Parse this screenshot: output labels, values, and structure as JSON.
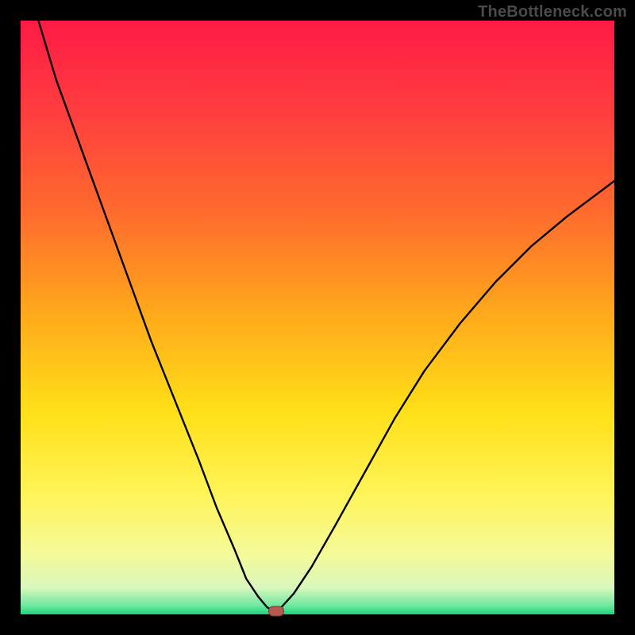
{
  "watermark": "TheBottleneck.com",
  "colors": {
    "background": "#000000",
    "curve": "#000000",
    "marker_fill": "#b4594f",
    "marker_stroke": "#7c3b34",
    "gradient_stops": [
      {
        "offset": 0.0,
        "color": "#ff1a45"
      },
      {
        "offset": 0.15,
        "color": "#ff3d3f"
      },
      {
        "offset": 0.32,
        "color": "#ff6a2e"
      },
      {
        "offset": 0.5,
        "color": "#ffab1a"
      },
      {
        "offset": 0.66,
        "color": "#ffe018"
      },
      {
        "offset": 0.8,
        "color": "#fff45a"
      },
      {
        "offset": 0.9,
        "color": "#f4fa9a"
      },
      {
        "offset": 0.955,
        "color": "#d9f7bc"
      },
      {
        "offset": 0.985,
        "color": "#6fe8a0"
      },
      {
        "offset": 1.0,
        "color": "#17d77b"
      }
    ]
  },
  "chart_data": {
    "type": "line",
    "title": "",
    "xlabel": "",
    "ylabel": "",
    "x_range": [
      0,
      100
    ],
    "y_range": [
      0,
      100
    ],
    "grid": false,
    "legend": false,
    "series": [
      {
        "name": "bottleneck-curve",
        "x": [
          3,
          6,
          10,
          14,
          18,
          22,
          26,
          30,
          33,
          36,
          38,
          40,
          41.5,
          42.5,
          43,
          44,
          46,
          49,
          53,
          58,
          63,
          68,
          74,
          80,
          86,
          92,
          100
        ],
        "y": [
          100,
          90,
          79,
          68,
          57,
          46,
          36,
          26,
          18,
          11,
          6,
          3,
          1.2,
          0.6,
          0.7,
          1.3,
          3.5,
          8,
          15,
          24,
          33,
          41,
          49,
          56,
          62,
          67,
          73
        ]
      }
    ],
    "marker": {
      "x": 43,
      "y": 0.6
    },
    "annotations": []
  }
}
